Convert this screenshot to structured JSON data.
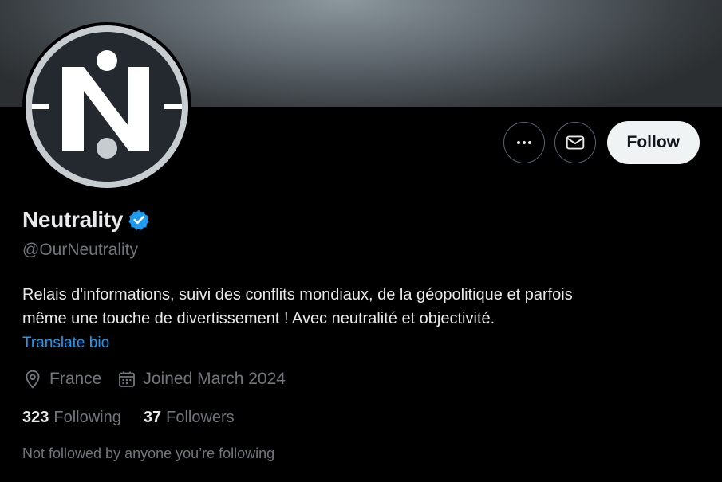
{
  "profile": {
    "name": "Neutrality",
    "handle": "@OurNeutrality",
    "bio_line1": "Relais d'informations, suivi des conflits mondiaux, de la géopolitique et parfois",
    "bio_line2": "même une touche de divertissement ! Avec neutralité et objectivité.",
    "translate_label": "Translate bio",
    "location": "France",
    "joined": "Joined March 2024",
    "following_count": "323",
    "following_label": "Following",
    "followers_count": "37",
    "followers_label": "Followers",
    "followed_by_notice": "Not followed by anyone you’re following"
  },
  "actions": {
    "more_icon": "more-horizontal-icon",
    "message_icon": "envelope-icon",
    "follow_label": "Follow"
  },
  "icons": {
    "verified": "verified-badge-icon",
    "location": "location-pin-icon",
    "calendar": "calendar-icon"
  },
  "colors": {
    "background": "#000000",
    "accent_blue": "#1d9bf0",
    "secondary_text": "#71767b",
    "primary_text": "#e7e9ea",
    "follow_button_bg": "#eff3f4",
    "avatar_ring": "#c7ccd0",
    "avatar_inner": "#23292e"
  }
}
